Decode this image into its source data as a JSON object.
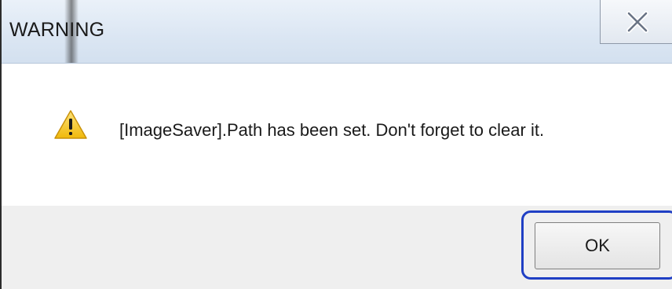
{
  "window": {
    "title": "WARNING",
    "close_icon": "close-icon"
  },
  "dialog": {
    "icon": "warning-icon",
    "message": "[ImageSaver].Path has been set.  Don't forget to clear it."
  },
  "buttons": {
    "ok_label": "OK"
  },
  "colors": {
    "title_bar": "#dbe6f3",
    "footer": "#efefef",
    "highlight": "#1f3fc4",
    "warning_yellow": "#f5c518"
  }
}
